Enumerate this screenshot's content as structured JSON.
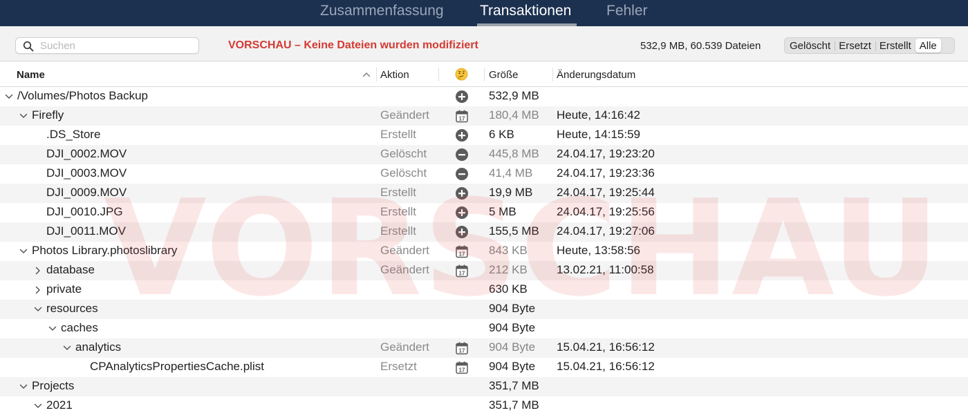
{
  "tabs": [
    {
      "label": "Zusammenfassung",
      "active": false
    },
    {
      "label": "Transaktionen",
      "active": true
    },
    {
      "label": "Fehler",
      "active": false
    }
  ],
  "toolbar": {
    "search_placeholder": "Suchen",
    "search_value": "",
    "preview_notice": "VORSCHAU – Keine Dateien wurden modifiziert",
    "totals": "532,9 MB, 60.539 Dateien",
    "filters": [
      {
        "label": "Gelöscht",
        "active": false
      },
      {
        "label": "Ersetzt",
        "active": false
      },
      {
        "label": "Erstellt",
        "active": false
      },
      {
        "label": "Alle",
        "active": true
      }
    ]
  },
  "columns": {
    "name": "Name",
    "action": "Aktion",
    "icon": "🤔",
    "size": "Größe",
    "date": "Änderungsdatum",
    "sort": "ascending"
  },
  "watermark": "VORSCHAU",
  "colors": {
    "tabbar_bg": "#1c3150",
    "created": "#3fb14a",
    "deleted": "#d2342e",
    "notice": "#d33a33"
  },
  "rows": [
    {
      "indent": 0,
      "disclosure": "expanded",
      "name": "/Volumes/Photos Backup",
      "name_style": "muted",
      "action": "",
      "icon": "plus-circle-icon",
      "size": "532,9 MB",
      "size_style": "dark",
      "date": ""
    },
    {
      "indent": 1,
      "disclosure": "expanded",
      "name": "Firefly",
      "name_style": "dark",
      "action": "Geändert",
      "icon": "calendar-icon",
      "size": "180,4 MB",
      "size_style": "muted",
      "date": "Heute, 14:16:42"
    },
    {
      "indent": 2,
      "disclosure": "none",
      "name": ".DS_Store",
      "name_style": "green",
      "action": "Erstellt",
      "icon": "plus-circle-icon",
      "size": "6 KB",
      "size_style": "dark",
      "date": "Heute, 14:15:59"
    },
    {
      "indent": 2,
      "disclosure": "none",
      "name": "DJI_0002.MOV",
      "name_style": "red",
      "action": "Gelöscht",
      "icon": "minus-circle-icon",
      "size": "445,8 MB",
      "size_style": "muted",
      "date": "24.04.17, 19:23:20"
    },
    {
      "indent": 2,
      "disclosure": "none",
      "name": "DJI_0003.MOV",
      "name_style": "red",
      "action": "Gelöscht",
      "icon": "minus-circle-icon",
      "size": "41,4 MB",
      "size_style": "muted",
      "date": "24.04.17, 19:23:36"
    },
    {
      "indent": 2,
      "disclosure": "none",
      "name": "DJI_0009.MOV",
      "name_style": "green",
      "action": "Erstellt",
      "icon": "plus-circle-icon",
      "size": "19,9 MB",
      "size_style": "dark",
      "date": "24.04.17, 19:25:44"
    },
    {
      "indent": 2,
      "disclosure": "none",
      "name": "DJI_0010.JPG",
      "name_style": "green",
      "action": "Erstellt",
      "icon": "plus-circle-icon",
      "size": "5 MB",
      "size_style": "dark",
      "date": "24.04.17, 19:25:56"
    },
    {
      "indent": 2,
      "disclosure": "none",
      "name": "DJI_0011.MOV",
      "name_style": "green",
      "action": "Erstellt",
      "icon": "plus-circle-icon",
      "size": "155,5 MB",
      "size_style": "dark",
      "date": "24.04.17, 19:27:06"
    },
    {
      "indent": 1,
      "disclosure": "expanded",
      "name": "Photos Library.photoslibrary",
      "name_style": "dark",
      "action": "Geändert",
      "icon": "calendar-icon",
      "size": "843 KB",
      "size_style": "muted",
      "date": "Heute, 13:58:56"
    },
    {
      "indent": 2,
      "disclosure": "collapsed",
      "name": "database",
      "name_style": "dark",
      "action": "Geändert",
      "icon": "calendar-icon",
      "size": "212 KB",
      "size_style": "muted",
      "date": "13.02.21, 11:00:58"
    },
    {
      "indent": 2,
      "disclosure": "collapsed",
      "name": "private",
      "name_style": "muted",
      "action": "",
      "icon": "",
      "size": "630 KB",
      "size_style": "dark",
      "date": ""
    },
    {
      "indent": 2,
      "disclosure": "expanded",
      "name": "resources",
      "name_style": "muted",
      "action": "",
      "icon": "",
      "size": "904 Byte",
      "size_style": "dark",
      "date": ""
    },
    {
      "indent": 3,
      "disclosure": "expanded",
      "name": "caches",
      "name_style": "muted",
      "action": "",
      "icon": "",
      "size": "904 Byte",
      "size_style": "dark",
      "date": ""
    },
    {
      "indent": 4,
      "disclosure": "expanded",
      "name": "analytics",
      "name_style": "dark",
      "action": "Geändert",
      "icon": "calendar-icon",
      "size": "904 Byte",
      "size_style": "muted",
      "date": "15.04.21, 16:56:12"
    },
    {
      "indent": 5,
      "disclosure": "none",
      "name": "CPAnalyticsPropertiesCache.plist",
      "name_style": "dark",
      "action": "Ersetzt",
      "icon": "calendar-icon",
      "size": "904 Byte",
      "size_style": "dark",
      "date": "15.04.21, 16:56:12"
    },
    {
      "indent": 1,
      "disclosure": "expanded",
      "name": "Projects",
      "name_style": "muted",
      "action": "",
      "icon": "",
      "size": "351,7 MB",
      "size_style": "dark",
      "date": ""
    },
    {
      "indent": 2,
      "disclosure": "expanded",
      "name": "2021",
      "name_style": "muted",
      "action": "",
      "icon": "",
      "size": "351,7 MB",
      "size_style": "dark",
      "date": ""
    }
  ]
}
